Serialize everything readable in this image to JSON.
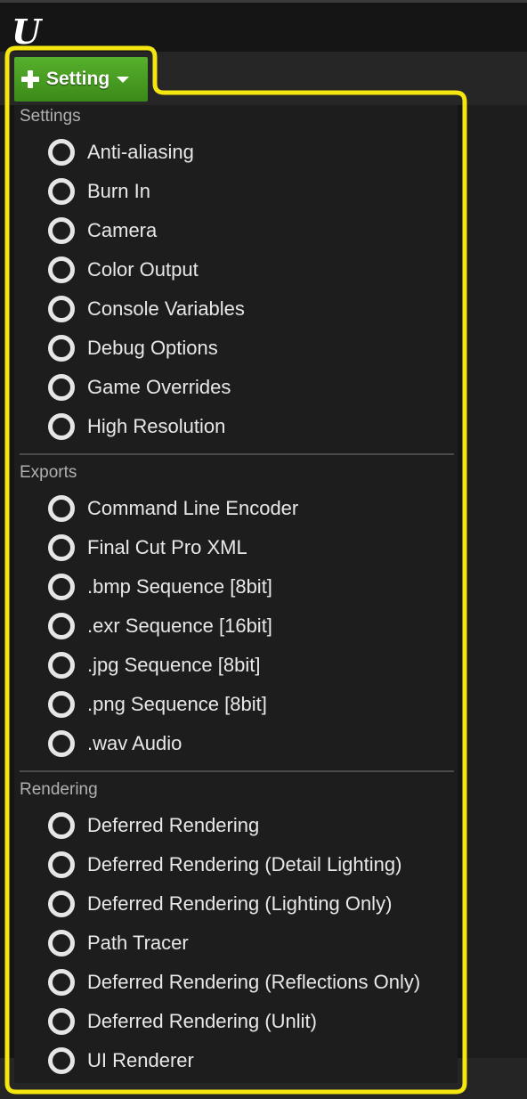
{
  "app": {
    "logo_text": "U"
  },
  "add_button": {
    "label": "Setting"
  },
  "sections": [
    {
      "header": "Settings",
      "items": [
        "Anti-aliasing",
        "Burn In",
        "Camera",
        "Color Output",
        "Console Variables",
        "Debug Options",
        "Game Overrides",
        "High Resolution"
      ]
    },
    {
      "header": "Exports",
      "items": [
        "Command Line Encoder",
        "Final Cut Pro XML",
        ".bmp Sequence [8bit]",
        ".exr Sequence [16bit]",
        ".jpg Sequence [8bit]",
        ".png Sequence [8bit]",
        ".wav Audio"
      ]
    },
    {
      "header": "Rendering",
      "items": [
        "Deferred Rendering",
        "Deferred Rendering (Detail Lighting)",
        "Deferred Rendering (Lighting Only)",
        "Path Tracer",
        "Deferred Rendering (Reflections Only)",
        "Deferred Rendering (Unlit)",
        "UI Renderer"
      ]
    }
  ],
  "colors": {
    "accent_green": "#4a9e22",
    "highlight_yellow": "#f5e60f",
    "menu_background": "#1d1d1d"
  }
}
